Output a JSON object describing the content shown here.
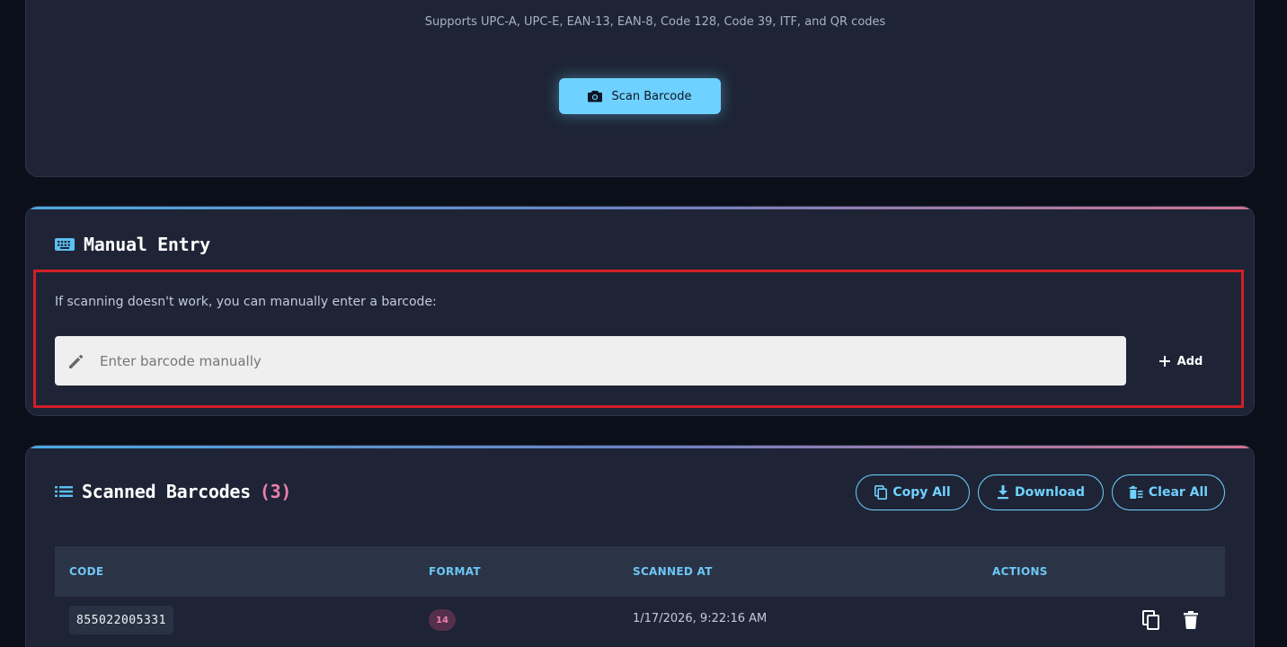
{
  "scanner": {
    "supports_text": "Supports UPC-A, UPC-E, EAN-13, EAN-8, Code 128, Code 39, ITF, and QR codes",
    "scan_button": "Scan Barcode",
    "scan_icon": "camera-icon"
  },
  "manual_entry": {
    "title": "Manual Entry",
    "title_icon": "keyboard-icon",
    "description": "If scanning doesn't work, you can manually enter a barcode:",
    "input_value": "",
    "input_placeholder": "Enter barcode manually",
    "input_icon": "pencil-icon",
    "add_button": "Add"
  },
  "scanned": {
    "title": "Scanned Barcodes",
    "count_text": "(3)",
    "title_icon": "list-icon",
    "buttons": {
      "copy_all": "Copy All",
      "download": "Download",
      "clear_all": "Clear All"
    },
    "columns": [
      "CODE",
      "FORMAT",
      "SCANNED AT",
      "ACTIONS"
    ],
    "rows": [
      {
        "code": "855022005331",
        "format": "14",
        "scanned_at": "1/17/2026, 9:22:16 AM"
      }
    ]
  },
  "colors": {
    "background": "#0b0f1a",
    "card": "#1e2435",
    "accent": "#6fd1ff",
    "pink": "#f07fae",
    "highlight_border": "#d01f25"
  }
}
